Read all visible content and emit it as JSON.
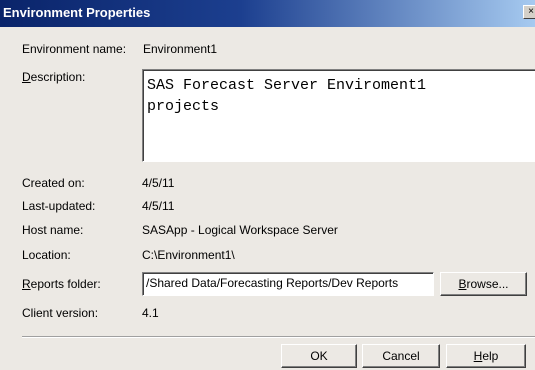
{
  "window": {
    "title": "Environment Properties",
    "close_label": "×"
  },
  "fields": {
    "environment_name": {
      "label": "Environment name:",
      "value": "Environment1"
    },
    "description": {
      "label": "Description:",
      "value": "SAS Forecast Server Enviroment1\nprojects"
    },
    "created_on": {
      "label": "Created on:",
      "value": "4/5/11"
    },
    "last_updated": {
      "label": "Last-updated:",
      "value": "4/5/11"
    },
    "host_name": {
      "label": "Host name:",
      "value": "SASApp - Logical Workspace Server"
    },
    "location": {
      "label": "Location:",
      "value": "C:\\Environment1\\"
    },
    "reports_folder": {
      "label": "Reports folder:",
      "value": "/Shared Data/Forecasting Reports/Dev Reports"
    },
    "client_version": {
      "label": "Client version:",
      "value": "4.1"
    }
  },
  "buttons": {
    "browse": "Browse...",
    "ok": "OK",
    "cancel": "Cancel",
    "help": "Help"
  }
}
